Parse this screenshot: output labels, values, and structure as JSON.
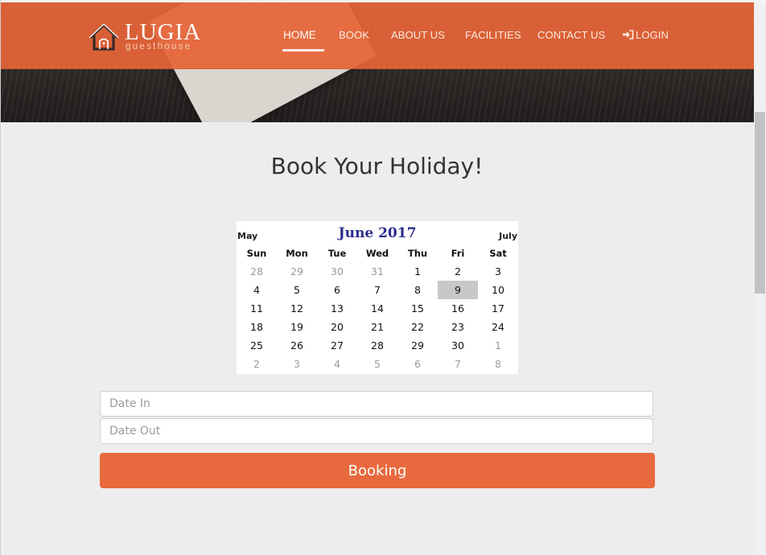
{
  "brand": {
    "name": "LUGIA",
    "tagline": "guesthouse"
  },
  "nav": {
    "items": [
      {
        "label": "HOME",
        "active": true
      },
      {
        "label": "BOOK"
      },
      {
        "label": "ABOUT US"
      },
      {
        "label": "FACILITIES"
      },
      {
        "label": "CONTACT US"
      },
      {
        "label": "LOGIN",
        "icon": "login-icon"
      }
    ]
  },
  "page": {
    "title": "Book Your Holiday!"
  },
  "calendar": {
    "month_label": "June 2017",
    "prev_label": "May",
    "next_label": "July",
    "weekdays": [
      "Sun",
      "Mon",
      "Tue",
      "Wed",
      "Thu",
      "Fri",
      "Sat"
    ],
    "weeks": [
      [
        "28",
        "29",
        "30",
        "31",
        "1",
        "2",
        "3"
      ],
      [
        "4",
        "5",
        "6",
        "7",
        "8",
        "9",
        "10"
      ],
      [
        "11",
        "12",
        "13",
        "14",
        "15",
        "16",
        "17"
      ],
      [
        "18",
        "19",
        "20",
        "21",
        "22",
        "23",
        "24"
      ],
      [
        "25",
        "26",
        "27",
        "28",
        "29",
        "30",
        "1"
      ],
      [
        "2",
        "3",
        "4",
        "5",
        "6",
        "7",
        "8"
      ]
    ],
    "selected_day": "9"
  },
  "form": {
    "date_in_placeholder": "Date In",
    "date_out_placeholder": "Date Out",
    "submit_label": "Booking"
  },
  "colors": {
    "accent": "#e8693d",
    "calendar_title": "#2b2e8c",
    "selected_day_bg": "#c8c8c8"
  }
}
